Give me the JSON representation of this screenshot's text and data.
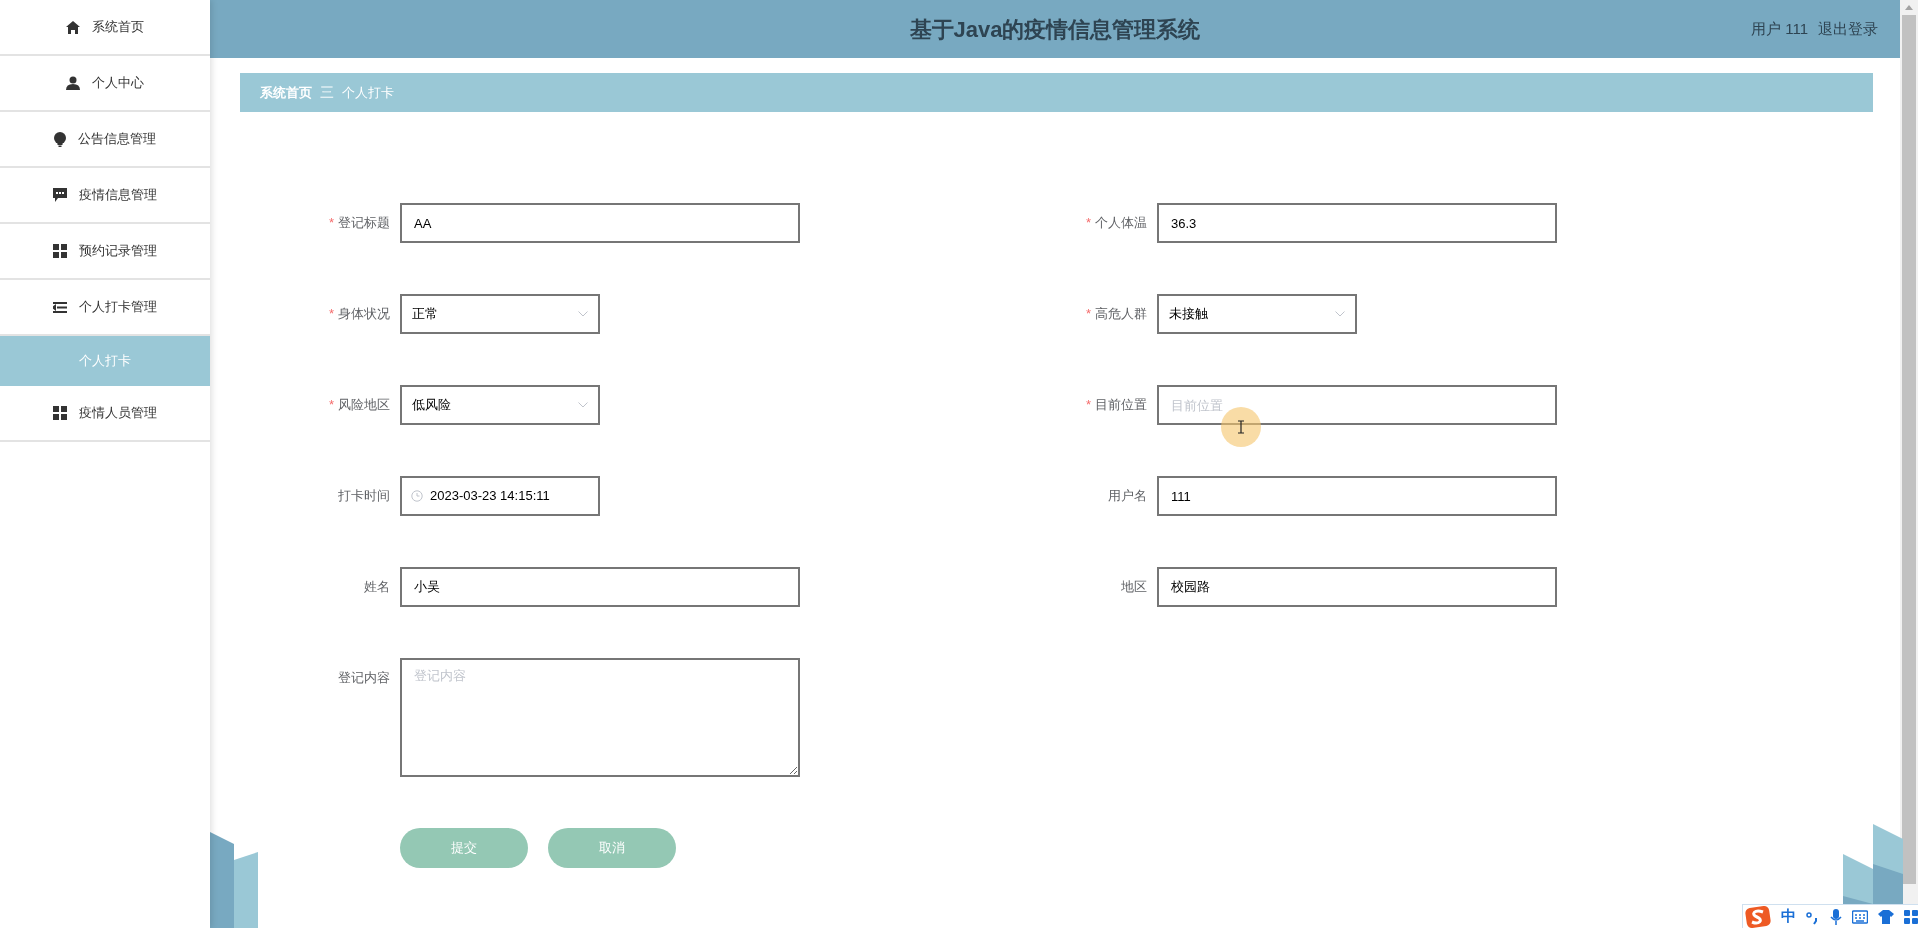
{
  "header": {
    "title": "基于Java的疫情信息管理系统",
    "user_label": "用户 111",
    "logout": "退出登录"
  },
  "sidebar": {
    "items": [
      {
        "label": "系统首页",
        "selected": false
      },
      {
        "label": "个人中心",
        "selected": false
      },
      {
        "label": "公告信息管理",
        "selected": false
      },
      {
        "label": "疫情信息管理",
        "selected": false
      },
      {
        "label": "预约记录管理",
        "selected": false
      },
      {
        "label": "个人打卡管理",
        "selected": false,
        "expanded": true,
        "children": [
          {
            "label": "个人打卡",
            "selected": true
          }
        ]
      },
      {
        "label": "疫情人员管理",
        "selected": false
      }
    ]
  },
  "breadcrumb": {
    "items": [
      "系统首页",
      "个人打卡"
    ],
    "separator": "三"
  },
  "form": {
    "rows": [
      [
        {
          "label": "登记标题",
          "required": true,
          "kind": "text",
          "value": "AA"
        },
        {
          "label": "个人体温",
          "required": true,
          "kind": "text",
          "value": "36.3"
        }
      ],
      [
        {
          "label": "身体状况",
          "required": true,
          "kind": "select",
          "value": "正常"
        },
        {
          "label": "高危人群",
          "required": true,
          "kind": "select",
          "value": "未接触"
        }
      ],
      [
        {
          "label": "风险地区",
          "required": true,
          "kind": "select",
          "value": "低风险"
        },
        {
          "label": "目前位置",
          "required": true,
          "kind": "text",
          "placeholder": "目前位置"
        }
      ],
      [
        {
          "label": "打卡时间",
          "required": false,
          "kind": "datetime",
          "value": "2023-03-23 14:15:11"
        },
        {
          "label": "用户名",
          "required": false,
          "kind": "text",
          "value": "111"
        }
      ],
      [
        {
          "label": "姓名",
          "required": false,
          "kind": "text",
          "value": "小吴"
        },
        {
          "label": "地区",
          "required": false,
          "kind": "text",
          "value": "校园路"
        }
      ],
      [
        {
          "label": "登记内容",
          "required": false,
          "kind": "textarea",
          "placeholder": "登记内容"
        }
      ]
    ],
    "required_mark": "*",
    "buttons": [
      "提交",
      "取消"
    ]
  },
  "ime_toolbar": {
    "mode": "中"
  }
}
